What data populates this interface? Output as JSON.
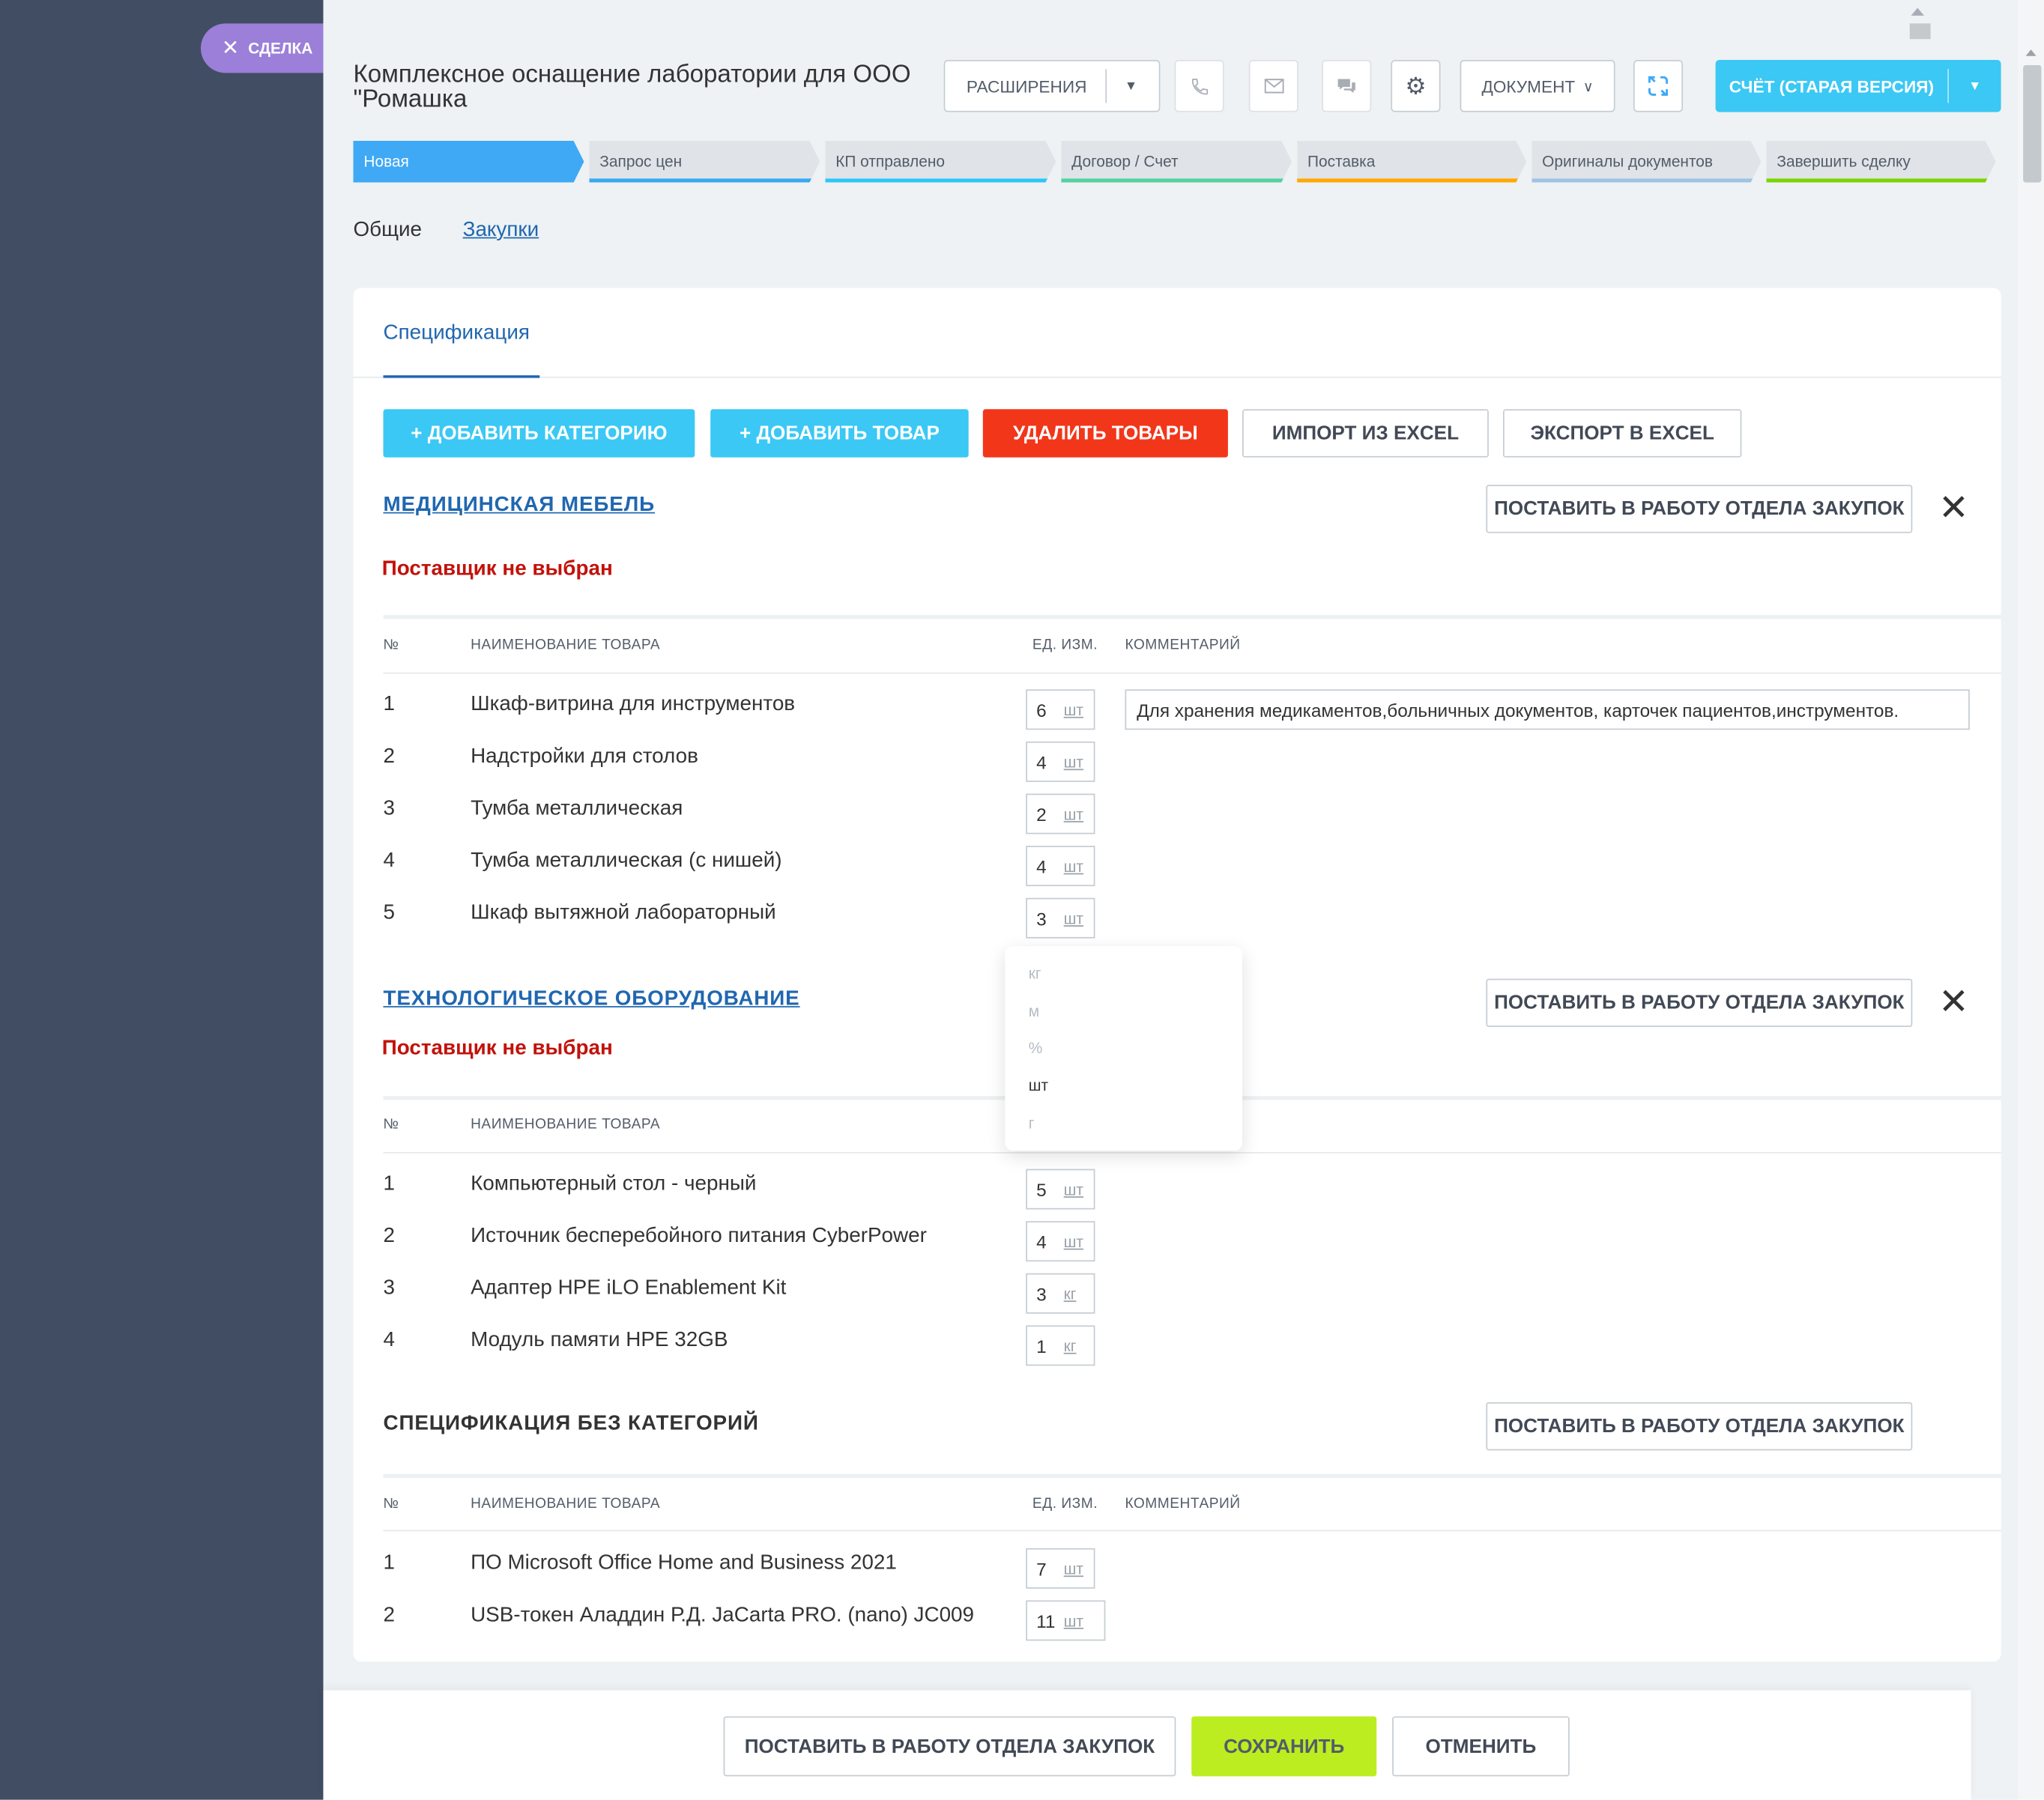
{
  "sidebar": {
    "deal_label": "СДЕЛКА",
    "close_icon": "close-icon"
  },
  "header": {
    "title": "Комплексное оснащение лаборатории для ООО \"Ромашка",
    "extensions_label": "РАСШИРЕНИЯ",
    "document_label": "ДОКУМЕНТ",
    "invoice_label": "СЧЁТ (СТАРАЯ ВЕРСИЯ)",
    "icons": [
      "phone-icon",
      "mail-icon",
      "chat-icon",
      "gear-icon",
      "refresh-icon"
    ]
  },
  "stages": [
    {
      "label": "Новая",
      "color": "#3fa9f5"
    },
    {
      "label": "Запрос цен",
      "color": "#39a8ef"
    },
    {
      "label": "КП отправлено",
      "color": "#2fc6f6"
    },
    {
      "label": "Договор / Счет",
      "color": "#55d0a0"
    },
    {
      "label": "Поставка",
      "color": "#ffa900"
    },
    {
      "label": "Оригиналы документов",
      "color": "#9fc2e5"
    },
    {
      "label": "Завершить сделку",
      "color": "#7bd500"
    }
  ],
  "tabs": {
    "general": "Общие",
    "purchases": "Закупки"
  },
  "spec": {
    "tab_label": "Спецификация",
    "actions": {
      "add_category": "+ ДОБАВИТЬ КАТЕГОРИЮ",
      "add_product": "+ ДОБАВИТЬ ТОВАР",
      "delete_products": "УДАЛИТЬ ТОВАРЫ",
      "import_excel": "ИМПОРТ ИЗ EXCEL",
      "export_excel": "ЭКСПОРТ В EXCEL"
    },
    "send_label": "ПОСТАВИТЬ В РАБОТУ ОТДЕЛА ЗАКУПОК",
    "supplier_missing": "Поставщик не выбран",
    "columns": {
      "num": "№",
      "name": "НАИМЕНОВАНИЕ ТОВАРА",
      "unit": "ЕД. ИЗМ.",
      "comment": "КОММЕНТАРИЙ"
    },
    "categories": [
      {
        "title": "МЕДИЦИНСКАЯ МЕБЕЛЬ",
        "rows": [
          {
            "num": "1",
            "name": "Шкаф-витрина для инструментов",
            "qty": "6",
            "unit": "шт",
            "comment": "Для хранения медикаментов,больничных документов, карточек пациентов,инструментов."
          },
          {
            "num": "2",
            "name": "Надстройки для столов",
            "qty": "4",
            "unit": "шт"
          },
          {
            "num": "3",
            "name": "Тумба металлическая",
            "qty": "2",
            "unit": "шт"
          },
          {
            "num": "4",
            "name": "Тумба металлическая (с нишей)",
            "qty": "4",
            "unit": "шт"
          },
          {
            "num": "5",
            "name": "Шкаф вытяжной лабораторный",
            "qty": "3",
            "unit": "шт"
          }
        ]
      },
      {
        "title": "ТЕХНОЛОГИЧЕСКОЕ ОБОРУДОВАНИЕ",
        "rows": [
          {
            "num": "1",
            "name": "Компьютерный стол - черный",
            "qty": "5",
            "unit": "шт"
          },
          {
            "num": "2",
            "name": "Источник бесперебойного питания CyberPower",
            "qty": "4",
            "unit": "шт"
          },
          {
            "num": "3",
            "name": "Адаптер HPE iLO Enablement Kit",
            "qty": "3",
            "unit": "кг"
          },
          {
            "num": "4",
            "name": "Модуль памяти HPE 32GB",
            "qty": "1",
            "unit": "кг"
          }
        ]
      },
      {
        "title": "СПЕЦИФИКАЦИЯ БЕЗ КАТЕГОРИЙ",
        "rows": [
          {
            "num": "1",
            "name": "ПО Microsoft Office Home and Business 2021",
            "qty": "7",
            "unit": "шт"
          },
          {
            "num": "2",
            "name": "USB-токен Аладдин Р.Д. JaCarta PRO. (nano) JC009",
            "qty": "11",
            "unit": "шт"
          }
        ]
      }
    ],
    "unit_dropdown": {
      "options": [
        "кг",
        "м",
        "%",
        "шт",
        "г"
      ],
      "selected": "шт"
    }
  },
  "footer": {
    "send": "ПОСТАВИТЬ В РАБОТУ ОТДЕЛА ЗАКУПОК",
    "save": "СОХРАНИТЬ",
    "cancel": "ОТМЕНИТЬ"
  }
}
